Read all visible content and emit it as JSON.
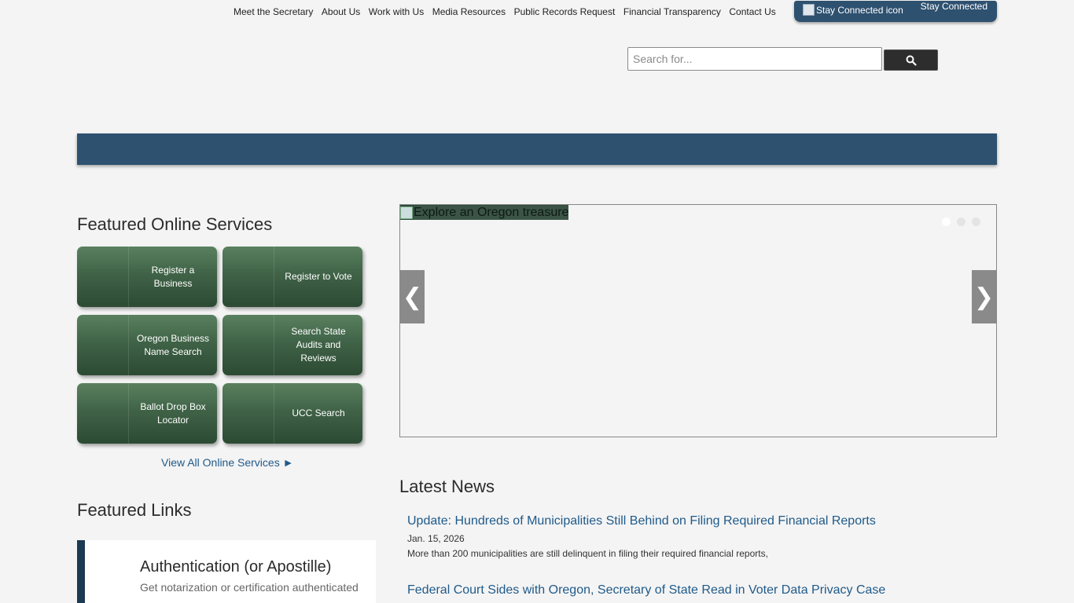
{
  "top_nav": {
    "links": [
      "Meet the Secretary",
      "About Us",
      "Work with Us",
      "Media Resources",
      "Public Records Request",
      "Financial Transparency",
      "Contact Us"
    ],
    "stay_connected_alt": "Stay Connected icon",
    "stay_connected_label": "Stay Connected"
  },
  "search": {
    "placeholder": "Search for...",
    "icon": "search-icon"
  },
  "featured_services": {
    "heading": "Featured Online Services",
    "buttons": [
      "Register a Business",
      "Register to Vote",
      "Oregon Business Name Search",
      "Search State Audits and Reviews",
      "Ballot Drop Box Locator",
      "UCC Search"
    ],
    "view_all": "View All Online Services ►"
  },
  "featured_links": {
    "heading": "Featured Links",
    "items": [
      {
        "title": "Authentication (or Apostille)",
        "subtitle": "Get notarization or certification authenticated"
      }
    ]
  },
  "carousel": {
    "slide_alt": "Explore an Oregon treasure",
    "prev": "❮",
    "next": "❯",
    "active_slide": 1,
    "slide_count": 3
  },
  "news": {
    "heading": "Latest News",
    "items": [
      {
        "title": "Update: Hundreds of Municipalities Still Behind on Filing Required Financial Reports",
        "date": "Jan. 15, 2026",
        "desc": "More than 200 municipalities are still delinquent in filing their required financial reports,"
      },
      {
        "title": "Federal Court Sides with Oregon, Secretary of State Read in Voter Data Privacy Case"
      }
    ]
  },
  "colors": {
    "brand_blue": "#2e5170",
    "service_green": "#406347",
    "link_blue": "#1f5a8a"
  }
}
